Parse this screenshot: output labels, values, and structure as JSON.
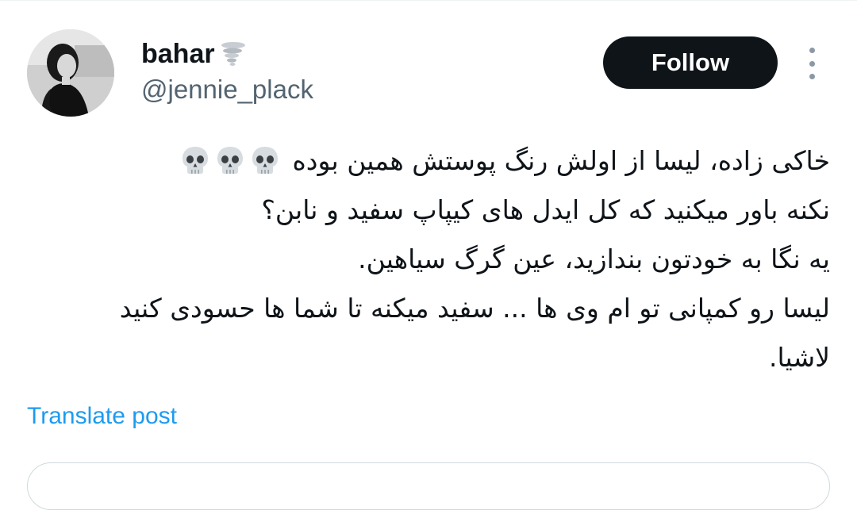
{
  "user": {
    "display_name": "bahar",
    "badge_icon": "tornado-icon",
    "handle": "@jennie_plack",
    "avatar": "profile-photo"
  },
  "actions": {
    "follow_label": "Follow",
    "more_icon": "more-vertical-icon"
  },
  "tweet": {
    "lines": [
      "خاکی زاده، لیسا از اولش رنگ پوستش همین بوده",
      "نکنه باور میکنید که کل ایدل های کیپاپ سفید و نابن؟",
      "یه نگا به خودتون بندازید، عین گرگ سیاهین.",
      "لیسا رو کمپانی تو ام وی ها ... سفید میکنه تا شما ها حسودی کنید",
      "لاشیا."
    ],
    "emoji_icon": "skull-icon"
  },
  "translate": {
    "label": "Translate post"
  },
  "colors": {
    "follow_bg": "#0f1419",
    "link": "#1d9bf0",
    "secondary_text": "#536471"
  }
}
